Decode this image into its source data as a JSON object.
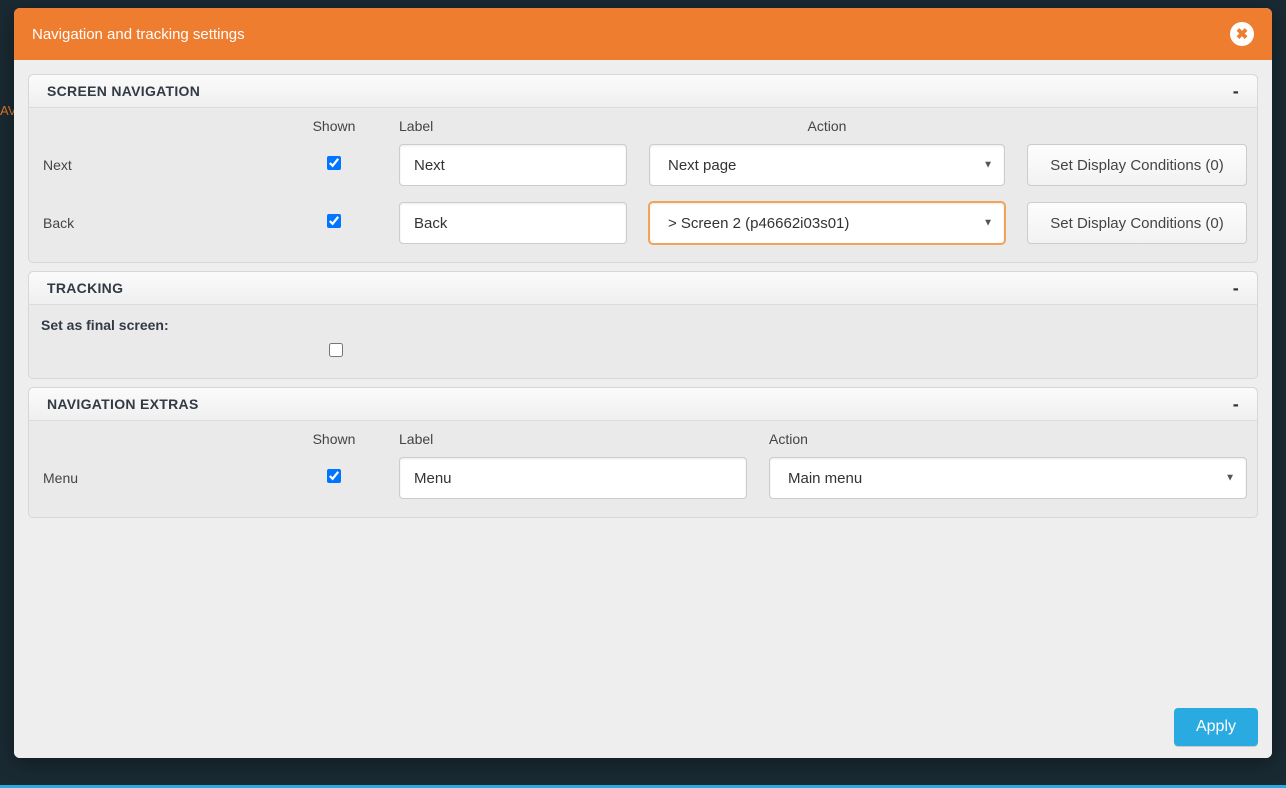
{
  "modal": {
    "title": "Navigation and tracking settings",
    "apply": "Apply"
  },
  "screenNav": {
    "heading": "SCREEN NAVIGATION",
    "columns": {
      "shown": "Shown",
      "label": "Label",
      "action": "Action"
    },
    "rows": [
      {
        "name": "Next",
        "shown": true,
        "labelValue": "Next",
        "actionValue": "Next page",
        "conditions": "Set Display Conditions (0)"
      },
      {
        "name": "Back",
        "shown": true,
        "labelValue": "Back",
        "actionValue": "> Screen 2 (p46662i03s01)",
        "conditions": "Set Display Conditions (0)"
      }
    ]
  },
  "tracking": {
    "heading": "TRACKING",
    "finalLabel": "Set as final screen:",
    "finalChecked": false
  },
  "extras": {
    "heading": "NAVIGATION EXTRAS",
    "columns": {
      "shown": "Shown",
      "label": "Label",
      "action": "Action"
    },
    "row": {
      "name": "Menu",
      "shown": true,
      "labelValue": "Menu",
      "actionValue": "Main menu"
    }
  }
}
